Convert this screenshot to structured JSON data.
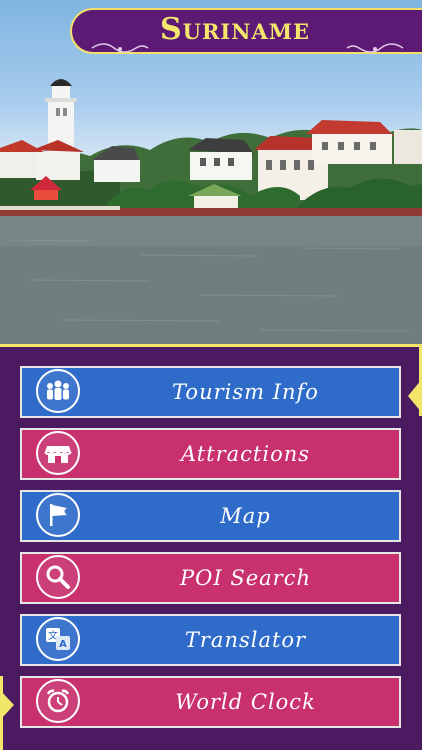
{
  "app": {
    "title": "Suriname"
  },
  "menu": {
    "items": [
      {
        "label": "Tourism Info",
        "icon": "people-group-icon",
        "color": "#2f6bc9"
      },
      {
        "label": "Attractions",
        "icon": "storefront-icon",
        "color": "#c8306e"
      },
      {
        "label": "Map",
        "icon": "flag-icon",
        "color": "#2f6bc9"
      },
      {
        "label": "POI Search",
        "icon": "magnifier-icon",
        "color": "#c8306e"
      },
      {
        "label": "Translator",
        "icon": "translate-icon",
        "color": "#2f6bc9"
      },
      {
        "label": "World Clock",
        "icon": "alarm-clock-icon",
        "color": "#c8306e"
      }
    ]
  },
  "colors": {
    "accent_yellow": "#f2e66a",
    "panel_purple": "#4c1a60",
    "banner_purple": "#5c1a74"
  }
}
